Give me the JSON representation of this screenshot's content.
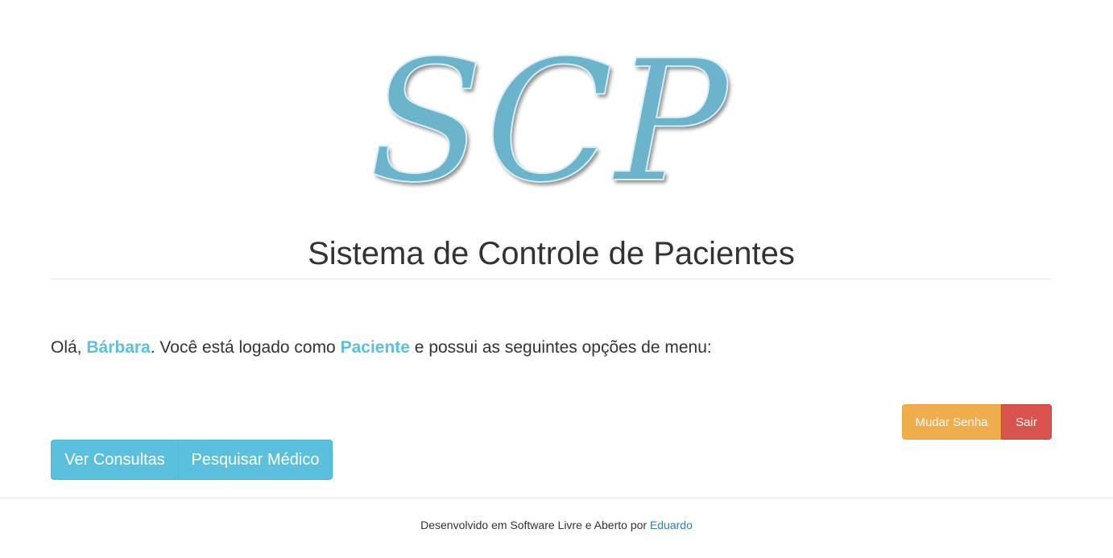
{
  "logo": {
    "text": "SCP",
    "color": "#6cb4cc"
  },
  "header": {
    "title": "Sistema de Controle de Pacientes"
  },
  "greeting": {
    "prefix": "Olá, ",
    "user_name": "Bárbara",
    "middle": ". Você está logado como ",
    "role": "Paciente",
    "suffix": " e possui as seguintes opções de menu:"
  },
  "account_actions": {
    "change_password_label": "Mudar Senha",
    "logout_label": "Sair"
  },
  "menu": {
    "items": [
      {
        "label": "Ver Consultas"
      },
      {
        "label": "Pesquisar Médico"
      }
    ]
  },
  "footer": {
    "text": "Desenvolvido em Software Livre e Aberto por ",
    "author_link": "Eduardo"
  },
  "colors": {
    "info": "#5bc0de",
    "warning": "#f0ad4e",
    "danger": "#d9534f",
    "link": "#337ab7"
  }
}
